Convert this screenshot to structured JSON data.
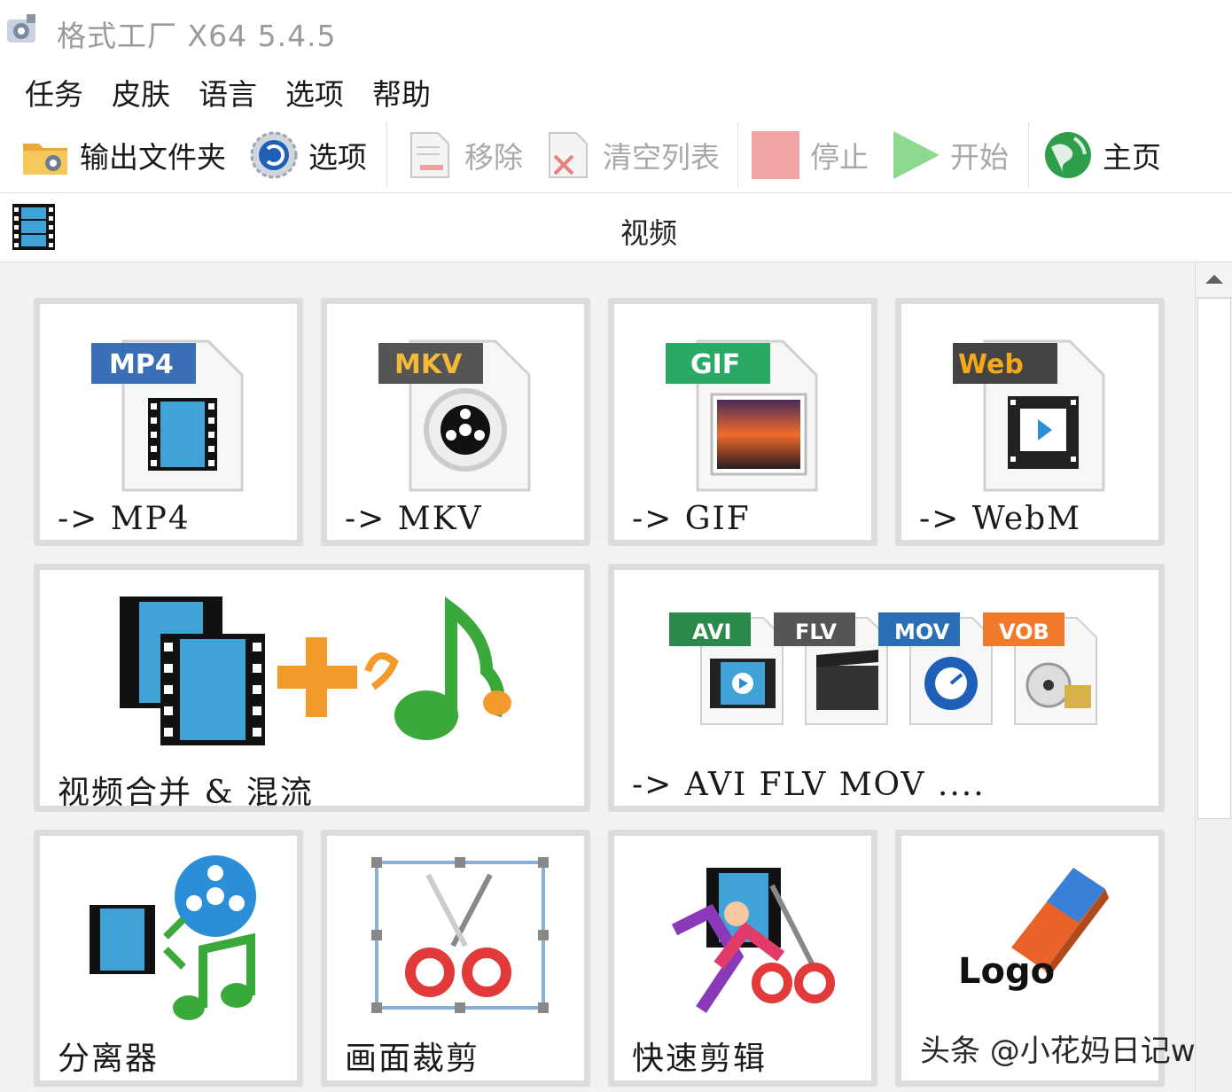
{
  "window": {
    "title": "格式工厂 X64 5.4.5"
  },
  "menu": {
    "items": [
      {
        "label": "任务"
      },
      {
        "label": "皮肤"
      },
      {
        "label": "语言"
      },
      {
        "label": "选项"
      },
      {
        "label": "帮助"
      }
    ]
  },
  "toolbar": {
    "output_folder": "输出文件夹",
    "options": "选项",
    "remove": "移除",
    "clear_list": "清空列表",
    "stop": "停止",
    "start": "开始",
    "home": "主页"
  },
  "category": {
    "title": "视频"
  },
  "tiles": [
    {
      "label": "-> MP4",
      "badge": "MP4",
      "badge_color": "#3a6fb5"
    },
    {
      "label": "-> MKV",
      "badge": "MKV",
      "badge_color": "#555555"
    },
    {
      "label": "-> GIF",
      "badge": "GIF",
      "badge_color": "#2aa866"
    },
    {
      "label": "-> WebM",
      "badge": "Web",
      "badge_color": "#444444"
    },
    {
      "label": "视频合并 & 混流"
    },
    {
      "label": "-> AVI FLV MOV ....",
      "badges": [
        "AVI",
        "FLV",
        "MOV",
        "VOB"
      ]
    },
    {
      "label": "分离器"
    },
    {
      "label": "画面裁剪"
    },
    {
      "label": "快速剪辑"
    },
    {
      "label": "Logo"
    }
  ],
  "watermark": {
    "text": "头条 @小花妈日记w"
  },
  "colors": {
    "stop_square": "#f0a0a0",
    "start_triangle": "#8fd88f",
    "tile_border": "#dcdcdc",
    "content_bg": "#f2f2f2"
  }
}
